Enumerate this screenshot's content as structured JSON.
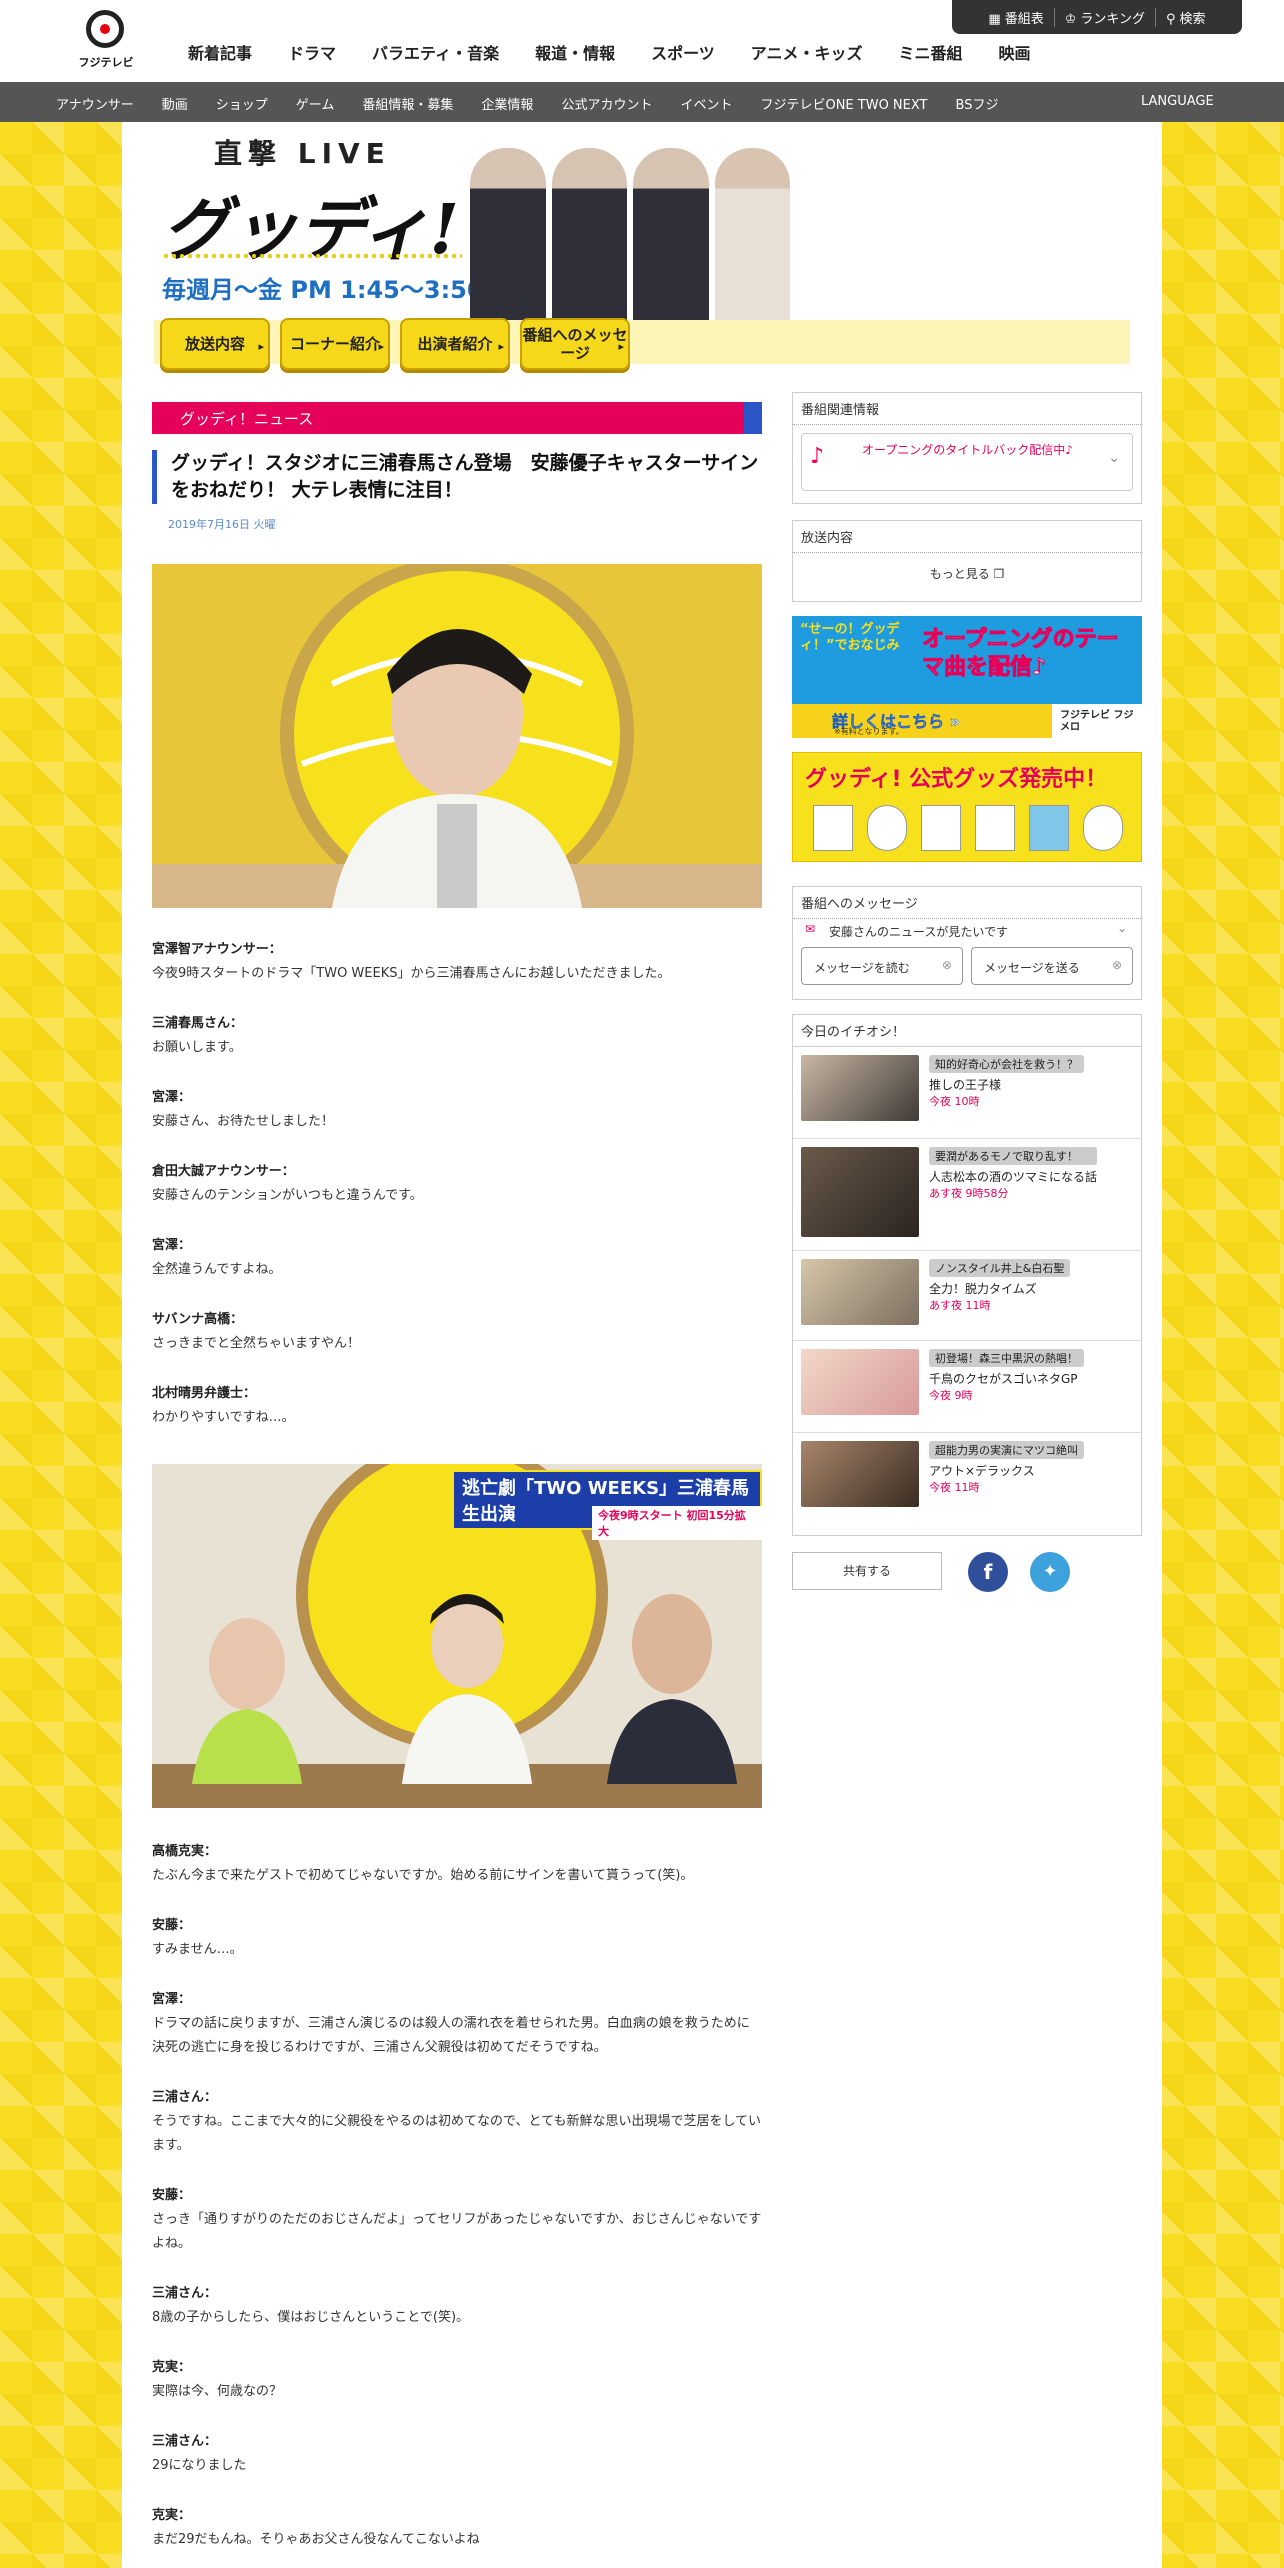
{
  "header": {
    "logo_text": "フジテレビ",
    "nav": [
      "新着記事",
      "ドラマ",
      "バラエティ・音楽",
      "報道・情報",
      "スポーツ",
      "アニメ・キッズ",
      "ミニ番組",
      "映画"
    ],
    "util": [
      "番組表",
      "ランキング",
      "検索"
    ]
  },
  "subnav": {
    "items": [
      "アナウンサー",
      "動画",
      "ショップ",
      "ゲーム",
      "番組情報・募集",
      "企業情報",
      "公式アカウント",
      "イベント",
      "フジテレビONE TWO NEXT",
      "BSフジ"
    ],
    "language": "LANGUAGE"
  },
  "banner": {
    "title_small": "直撃 LIVE",
    "title_big": "グッディ!",
    "schedule": "毎週月〜金 PM 1:45〜3:50",
    "buttons": [
      "放送内容",
      "コーナー紹介",
      "出演者紹介",
      "番組へのメッセージ"
    ]
  },
  "article": {
    "category": "グッディ！ニュース",
    "title": "グッディ！スタジオに三浦春馬さん登場　安藤優子キャスターサインをおねだり！ 大テレ表情に注目！",
    "date": "2019年7月16日 火曜",
    "photo2_caption": "逃亡劇「TWO WEEKS」三浦春馬 生出演",
    "photo2_sub": "今夜9時スタート 初回15分拡大",
    "dialogue1": [
      {
        "speaker": "宮澤智アナウンサー：",
        "line": "今夜9時スタートのドラマ「TWO WEEKS」から三浦春馬さんにお越しいただきました。"
      },
      {
        "speaker": "三浦春馬さん：",
        "line": "お願いします。"
      },
      {
        "speaker": "宮澤：",
        "line": "安藤さん、お待たせしました！"
      },
      {
        "speaker": "倉田大誠アナウンサー：",
        "line": "安藤さんのテンションがいつもと違うんです。"
      },
      {
        "speaker": "宮澤：",
        "line": "全然違うんですよね。"
      },
      {
        "speaker": "サバンナ高橋：",
        "line": "さっきまでと全然ちゃいますやん！"
      },
      {
        "speaker": "北村晴男弁護士：",
        "line": "わかりやすいですね…。"
      }
    ],
    "dialogue2": [
      {
        "speaker": "高橋克実：",
        "line": "たぶん今まで来たゲストで初めてじゃないですか。始める前にサインを書いて貰うって(笑)。"
      },
      {
        "speaker": "安藤：",
        "line": "すみません…。"
      },
      {
        "speaker": "宮澤：",
        "line": "ドラマの話に戻りますが、三浦さん演じるのは殺人の濡れ衣を着せられた男。白血病の娘を救うために決死の逃亡に身を投じるわけですが、三浦さん父親役は初めてだそうですね。"
      },
      {
        "speaker": "三浦さん：",
        "line": "そうですね。ここまで大々的に父親役をやるのは初めてなので、とても新鮮な思い出現場で芝居をしています。"
      },
      {
        "speaker": "安藤：",
        "line": "さっき「通りすがりのただのおじさんだよ」ってセリフがあったじゃないですか、おじさんじゃないですよね。"
      },
      {
        "speaker": "三浦さん：",
        "line": "8歳の子からしたら、僕はおじさんということで(笑)。"
      },
      {
        "speaker": "克実：",
        "line": "実際は今、何歳なの？"
      },
      {
        "speaker": "三浦さん：",
        "line": "29になりました"
      },
      {
        "speaker": "克実：",
        "line": "まだ29だもんね。そりゃあお父さん役なんてこないよね"
      }
    ]
  },
  "sidebar": {
    "related_head": "番組関連情報",
    "related_item": "オープニングのタイトルバック配信中♪",
    "broadcast_head": "放送内容",
    "more": "もっと見る",
    "promo1_a": "“せーの！グッディ！”でおなじみ",
    "promo1_b": "オープニングのテーマ曲を配信♪",
    "promo1_c": "詳しくはこちら »",
    "promo1_d": "※有料となります。",
    "promo1_e": "フジテレビ フジメロ",
    "promo2": "グッディ! 公式グッズ発売中！",
    "message_head": "番組へのメッセージ",
    "message_topic": "安藤さんのニュースが見たいです",
    "read_btn": "メッセージを読む",
    "send_btn": "メッセージを送る",
    "pick_head": "今日のイチオシ！",
    "picks": [
      {
        "tag": "知的好奇心が会社を救う！？",
        "name": "推しの王子様",
        "time": "今夜 10時"
      },
      {
        "tag": "要潤があるモノで取り乱す！",
        "name": "人志松本の酒のツマミになる話",
        "time": "あす夜 9時58分"
      },
      {
        "tag": "ノンスタイル井上&白石聖",
        "name": "全力！脱力タイムズ",
        "time": "あす夜 11時"
      },
      {
        "tag": "初登場！森三中黒沢の熱唱！",
        "name": "千鳥のクセがスゴいネタGP",
        "time": "今夜 9時"
      },
      {
        "tag": "超能力男の実演にマツコ絶叫",
        "name": "アウト×デラックス",
        "time": "今夜 11時"
      }
    ],
    "share": "共有する"
  },
  "colors": {
    "accent_pink": "#e5005a",
    "accent_blue": "#2a56c6",
    "yellow": "#f9dd22"
  }
}
